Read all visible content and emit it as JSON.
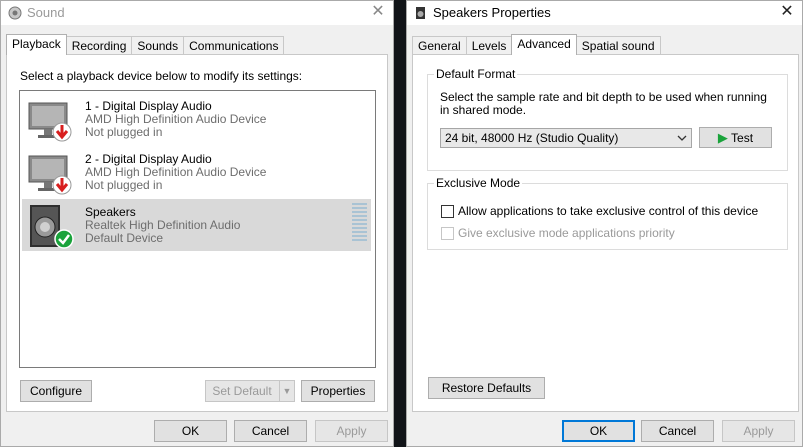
{
  "sound_window": {
    "title": "Sound",
    "tabs": [
      "Playback",
      "Recording",
      "Sounds",
      "Communications"
    ],
    "instruction": "Select a playback device below to modify its settings:",
    "devices": [
      {
        "name": "1 - Digital Display Audio",
        "driver": "AMD High Definition Audio Device",
        "status": "Not plugged in",
        "icon": "monitor-unplugged-icon"
      },
      {
        "name": "2 - Digital Display Audio",
        "driver": "AMD High Definition Audio Device",
        "status": "Not plugged in",
        "icon": "monitor-unplugged-icon"
      },
      {
        "name": "Speakers",
        "driver": "Realtek High Definition Audio",
        "status": "Default Device",
        "icon": "speaker-default-icon",
        "selected": true
      }
    ],
    "buttons": {
      "configure": "Configure",
      "set_default": "Set Default",
      "properties": "Properties",
      "ok": "OK",
      "cancel": "Cancel",
      "apply": "Apply"
    }
  },
  "speakers_window": {
    "title": "Speakers Properties",
    "tabs": [
      "General",
      "Levels",
      "Advanced",
      "Spatial sound"
    ],
    "default_format": {
      "group_title": "Default Format",
      "description_line1": "Select the sample rate and bit depth to be used when running",
      "description_line2": "in shared mode.",
      "selected_format": "24 bit, 48000 Hz (Studio Quality)",
      "test_label": "Test"
    },
    "exclusive_mode": {
      "group_title": "Exclusive Mode",
      "allow_exclusive": "Allow applications to take exclusive control of this device",
      "give_priority": "Give exclusive mode applications priority"
    },
    "buttons": {
      "restore_defaults": "Restore Defaults",
      "ok": "OK",
      "cancel": "Cancel",
      "apply": "Apply"
    }
  },
  "colors": {
    "selection": "#d9d9d9",
    "focus_blue": "#0078d7",
    "check_green": "#1aa33b",
    "unplugged_red": "#d81e1e"
  }
}
